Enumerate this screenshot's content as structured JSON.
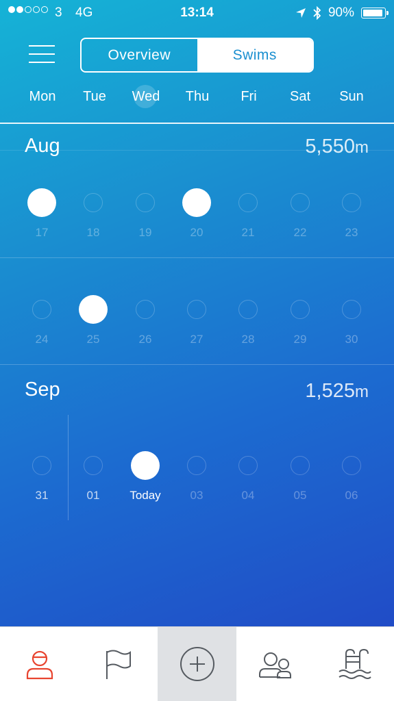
{
  "status_bar": {
    "signal_dots_filled": 2,
    "signal_dots_total": 5,
    "carrier": "3",
    "network": "4G",
    "time": "13:14",
    "battery": "90%",
    "icons": [
      "location-arrow-icon",
      "bluetooth-icon",
      "battery-icon"
    ]
  },
  "header": {
    "menu_icon": "hamburger-menu-icon",
    "segments": [
      {
        "label": "Overview",
        "active": false
      },
      {
        "label": "Swims",
        "active": true
      }
    ],
    "weekdays": [
      "Mon",
      "Tue",
      "Wed",
      "Thu",
      "Fri",
      "Sat",
      "Sun"
    ],
    "highlighted_weekday": "Wed"
  },
  "calendar": {
    "months": [
      {
        "name": "Aug",
        "total_value": "5,550",
        "total_unit": "m",
        "weeks": [
          [
            {
              "label": "17",
              "swim": true
            },
            {
              "label": "18",
              "swim": false
            },
            {
              "label": "19",
              "swim": false
            },
            {
              "label": "20",
              "swim": true
            },
            {
              "label": "21",
              "swim": false
            },
            {
              "label": "22",
              "swim": false
            },
            {
              "label": "23",
              "swim": false
            }
          ],
          [
            {
              "label": "24",
              "swim": false
            },
            {
              "label": "25",
              "swim": true
            },
            {
              "label": "26",
              "swim": false
            },
            {
              "label": "27",
              "swim": false
            },
            {
              "label": "28",
              "swim": false
            },
            {
              "label": "29",
              "swim": false
            },
            {
              "label": "30",
              "swim": false
            }
          ]
        ]
      },
      {
        "name": "Sep",
        "total_value": "1,525",
        "total_unit": "m",
        "weeks": [
          [
            {
              "label": "31",
              "swim": false
            },
            {
              "label": "01",
              "swim": false
            },
            {
              "label": "Today",
              "swim": true
            },
            {
              "label": "03",
              "swim": false
            },
            {
              "label": "04",
              "swim": false
            },
            {
              "label": "05",
              "swim": false
            },
            {
              "label": "06",
              "swim": false
            }
          ]
        ]
      }
    ]
  },
  "tab_bar": {
    "tabs": [
      {
        "icon": "profile-icon",
        "active": true
      },
      {
        "icon": "flag-icon",
        "active": false
      },
      {
        "icon": "add-circle-icon",
        "active": false
      },
      {
        "icon": "friends-icon",
        "active": false
      },
      {
        "icon": "pool-ladder-icon",
        "active": false
      }
    ]
  },
  "colors": {
    "accent": "#1a8fd0",
    "active_tab": "#e8442f",
    "inactive_tab": "#555a60",
    "gradient_top": "#15b3d6",
    "gradient_bottom": "#2243c4"
  }
}
